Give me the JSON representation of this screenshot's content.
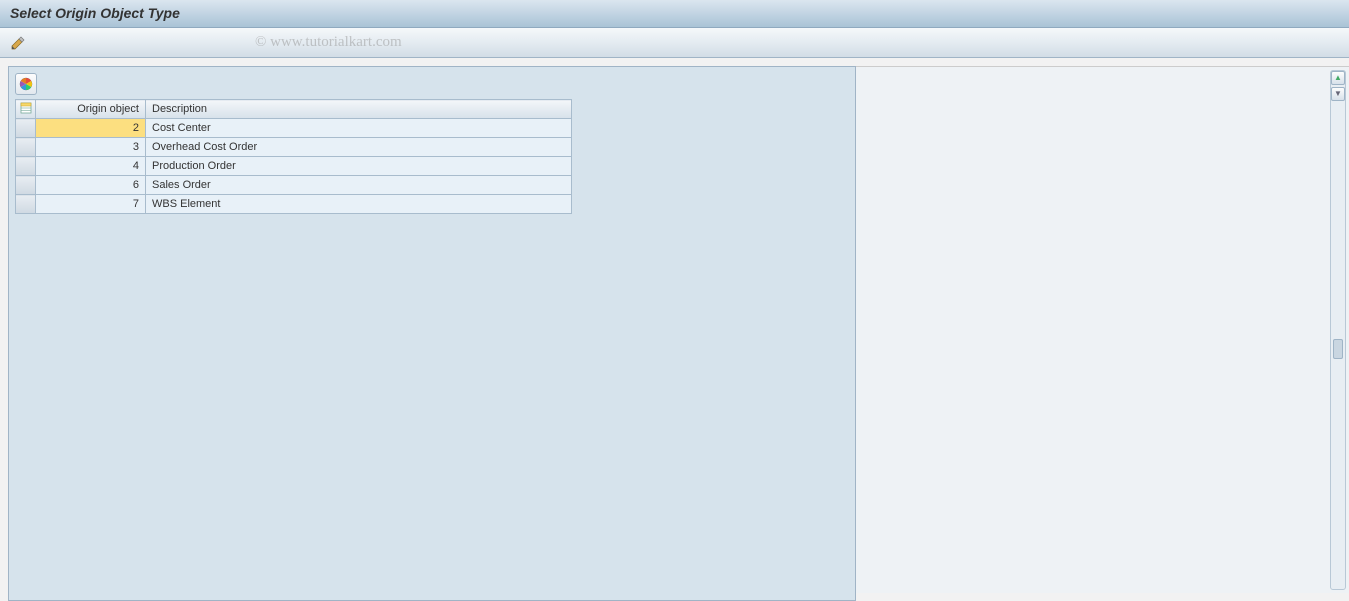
{
  "title": "Select Origin Object Type",
  "watermark": "© www.tutorialkart.com",
  "table": {
    "headers": {
      "origin": "Origin object",
      "description": "Description"
    },
    "rows": [
      {
        "origin": "2",
        "description": "Cost Center",
        "selected": true
      },
      {
        "origin": "3",
        "description": "Overhead Cost Order",
        "selected": false
      },
      {
        "origin": "4",
        "description": "Production Order",
        "selected": false
      },
      {
        "origin": "6",
        "description": "Sales Order",
        "selected": false
      },
      {
        "origin": "7",
        "description": "WBS Element",
        "selected": false
      }
    ]
  },
  "icons": {
    "edit": "edit-icon",
    "select_all": "select-all-icon",
    "color_legend": "color-wheel-icon"
  }
}
